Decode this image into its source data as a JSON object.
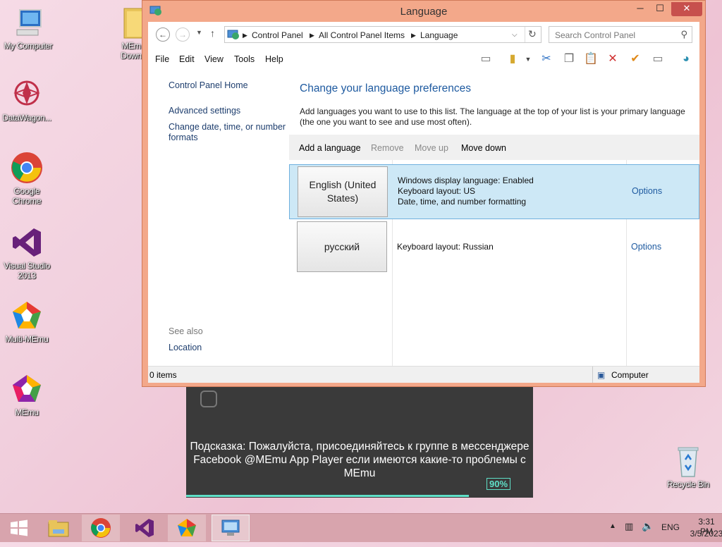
{
  "desktop": {
    "icons": [
      {
        "label": "My Computer"
      },
      {
        "label": "DataWagon..."
      },
      {
        "label": "Google Chrome"
      },
      {
        "label": "Visual Studio 2013"
      },
      {
        "label": "Multi-MEmu"
      },
      {
        "label": "MEmu"
      },
      {
        "label": "MEm Down"
      },
      {
        "label": "Recycle Bin"
      }
    ]
  },
  "window": {
    "title": "Language",
    "caption": {
      "minimize": "─",
      "maximize": "☐",
      "close": "✕"
    },
    "address": {
      "crumbs": [
        "Control Panel",
        "All Control Panel Items",
        "Language"
      ],
      "search_placeholder": "Search Control Panel"
    },
    "menu": [
      "File",
      "Edit",
      "View",
      "Tools",
      "Help"
    ],
    "left_pane": {
      "home": "Control Panel Home",
      "advanced": "Advanced settings",
      "change_date": "Change date, time, or number formats",
      "see_also": "See also",
      "location": "Location"
    },
    "main": {
      "heading": "Change your language preferences",
      "description": "Add languages you want to use to this list. The language at the top of your list is your primary language (the one you want to see and use most often).",
      "commands": {
        "add": "Add a language",
        "remove": "Remove",
        "move_up": "Move up",
        "move_down": "Move down"
      },
      "languages": [
        {
          "name": "English (United States)",
          "info": [
            "Windows display language: Enabled",
            "Keyboard layout: US",
            "Date, time, and number formatting"
          ],
          "options": "Options",
          "selected": true
        },
        {
          "name": "русский",
          "info": [
            "Keyboard layout: Russian"
          ],
          "options": "Options",
          "selected": false
        }
      ]
    },
    "status": {
      "items": "0 items",
      "computer": "Computer"
    }
  },
  "overlay": {
    "tip": "Подсказка: Пожалуйста, присоединяйтесь к группе в мессенджере Facebook @MEmu App Player если имеются какие-то проблемы с MEmu",
    "percent": "90%",
    "progress": 0.9
  },
  "taskbar": {
    "lang": "ENG",
    "time": "3:31 PM",
    "date": "3/5/2023"
  },
  "colors": {
    "accent": "#1e5aa0",
    "selected_row": "#cde8f6",
    "window_frame": "#f3a88a",
    "progress": "#5fe0c8"
  }
}
